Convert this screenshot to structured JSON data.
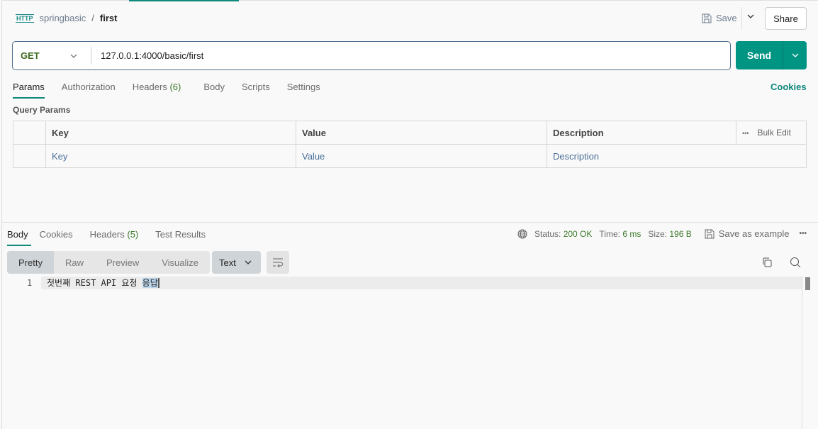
{
  "header": {
    "collection": "springbasic",
    "separator": "/",
    "request": "first",
    "save_label": "Save",
    "share_label": "Share",
    "http_icon_text": "HTTP"
  },
  "request": {
    "method": "GET",
    "url": "127.0.0.1:4000/basic/first",
    "send_label": "Send"
  },
  "request_tabs": [
    {
      "label": "Params"
    },
    {
      "label": "Authorization"
    },
    {
      "label": "Headers",
      "count": "(6)"
    },
    {
      "label": "Body"
    },
    {
      "label": "Scripts"
    },
    {
      "label": "Settings"
    }
  ],
  "cookies_label": "Cookies",
  "query_params": {
    "title": "Query Params",
    "columns": [
      "Key",
      "Value",
      "Description"
    ],
    "bulk_edit": "Bulk Edit",
    "placeholders": [
      "Key",
      "Value",
      "Description"
    ]
  },
  "response_tabs": [
    {
      "label": "Body"
    },
    {
      "label": "Cookies"
    },
    {
      "label": "Headers",
      "count": "(5)"
    },
    {
      "label": "Test Results"
    }
  ],
  "response_status": {
    "status_label": "Status:",
    "status": "200 OK",
    "time_label": "Time:",
    "time": "6 ms",
    "size_label": "Size:",
    "size": "196 B",
    "save_example": "Save as example"
  },
  "view_modes": [
    "Pretty",
    "Raw",
    "Preview",
    "Visualize"
  ],
  "format": "Text",
  "body": {
    "line_number": "1",
    "text": "첫번째 REST API 요청 ",
    "selected": "응답"
  }
}
